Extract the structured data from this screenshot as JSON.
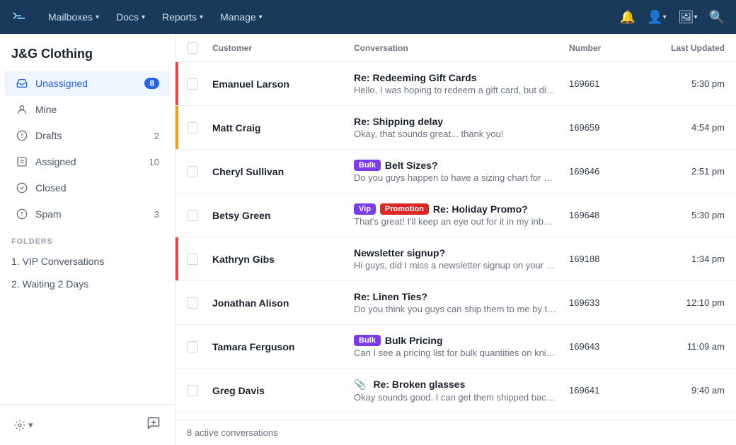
{
  "company": "J&G Clothing",
  "nav": {
    "items": [
      {
        "label": "Mailboxes",
        "has_dropdown": true
      },
      {
        "label": "Docs",
        "has_dropdown": true
      },
      {
        "label": "Reports",
        "has_dropdown": true
      },
      {
        "label": "Manage",
        "has_dropdown": true
      }
    ]
  },
  "sidebar": {
    "items": [
      {
        "id": "unassigned",
        "label": "Unassigned",
        "badge": "8",
        "icon": "inbox",
        "active": true
      },
      {
        "id": "mine",
        "label": "Mine",
        "badge": "",
        "icon": "user",
        "active": false
      },
      {
        "id": "drafts",
        "label": "Drafts",
        "badge": "2",
        "icon": "draft",
        "active": false
      },
      {
        "id": "assigned",
        "label": "Assigned",
        "badge": "10",
        "icon": "assign",
        "active": false
      },
      {
        "id": "closed",
        "label": "Closed",
        "badge": "",
        "icon": "closed",
        "active": false
      },
      {
        "id": "spam",
        "label": "Spam",
        "badge": "3",
        "icon": "spam",
        "active": false
      }
    ],
    "folders_label": "FOLDERS",
    "folders": [
      {
        "label": "1. VIP Conversations"
      },
      {
        "label": "2. Waiting 2 Days"
      }
    ]
  },
  "table": {
    "headers": [
      "",
      "Customer",
      "Conversation",
      "Number",
      "Last Updated"
    ],
    "rows": [
      {
        "id": 1,
        "priority": "high",
        "customer": "Emanuel Larson",
        "subject": "Re: Redeeming Gift Cards",
        "preview": "Hello, I was hoping to redeem a gift card, but didn't see a price",
        "number": "169661",
        "time": "5:30 pm",
        "tags": [],
        "has_attachment": false
      },
      {
        "id": 2,
        "priority": "medium",
        "customer": "Matt Craig",
        "subject": "Re: Shipping delay",
        "preview": "Okay, that sounds great... thank you!",
        "number": "169659",
        "time": "4:54 pm",
        "tags": [],
        "has_attachment": false
      },
      {
        "id": 3,
        "priority": "",
        "customer": "Cheryl Sullivan",
        "subject": "Belt Sizes?",
        "preview": "Do you guys happen to have a sizing chart for belts",
        "number": "169646",
        "time": "2:51 pm",
        "tags": [
          "bulk"
        ],
        "has_attachment": false
      },
      {
        "id": 4,
        "priority": "",
        "customer": "Betsy Green",
        "subject": "Re: Holiday Promo?",
        "preview": "That's great! I'll keep an eye out for it in my inbox :-)",
        "number": "169648",
        "time": "5:30 pm",
        "tags": [
          "vip",
          "promotion"
        ],
        "has_attachment": false
      },
      {
        "id": 5,
        "priority": "high",
        "customer": "Kathryn Gibs",
        "subject": "Newsletter signup?",
        "preview": "Hi guys, did I miss a newsletter signup on your blog? I'd love",
        "number": "169188",
        "time": "1:34 pm",
        "tags": [],
        "has_attachment": false
      },
      {
        "id": 6,
        "priority": "",
        "customer": "Jonathan Alison",
        "subject": "Re: Linen Ties?",
        "preview": "Do you think you guys can ship them to me by the end of the wee",
        "number": "169633",
        "time": "12:10 pm",
        "tags": [],
        "has_attachment": false
      },
      {
        "id": 7,
        "priority": "",
        "customer": "Tamara Ferguson",
        "subject": "Bulk Pricing",
        "preview": "Can I see a pricing list for bulk quantities on knit shirts?",
        "number": "169643",
        "time": "11:09 am",
        "tags": [
          "bulk"
        ],
        "has_attachment": false
      },
      {
        "id": 8,
        "priority": "",
        "customer": "Greg Davis",
        "subject": "Re: Broken glasses",
        "preview": "Okay sounds good. I can get them shipped back by friday",
        "number": "169641",
        "time": "9:40 am",
        "tags": [],
        "has_attachment": true
      }
    ]
  },
  "status_bar": "8 active conversations"
}
